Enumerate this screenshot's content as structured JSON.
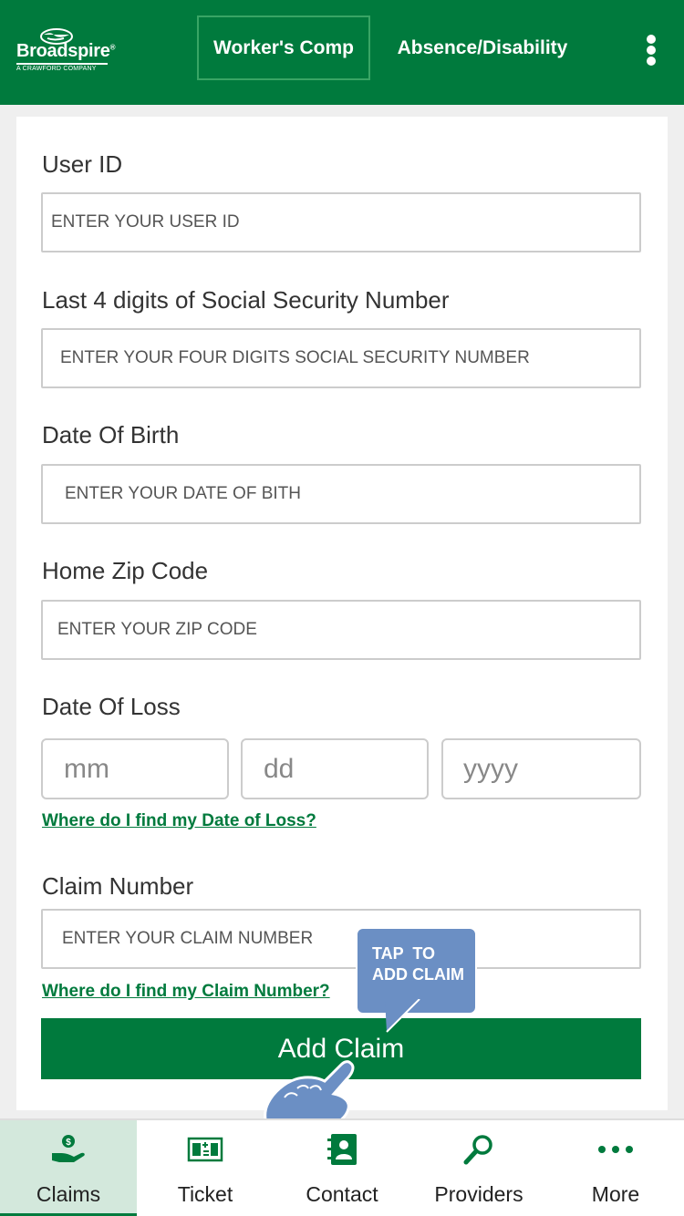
{
  "header": {
    "logo_name": "Broadspire",
    "logo_reg": "®",
    "logo_sub": "A CRAWFORD COMPANY",
    "tabs": [
      {
        "label": "Worker's Comp"
      },
      {
        "label": "Absence/Disability"
      }
    ],
    "menu_icon": "kebab-menu-icon"
  },
  "form": {
    "user_id_label": "User ID",
    "user_id_placeholder": "ENTER YOUR USER ID",
    "ssn_label": "Last 4 digits of Social Security Number",
    "ssn_placeholder": "ENTER YOUR FOUR DIGITS SOCIAL SECURITY NUMBER",
    "dob_label": "Date Of Birth",
    "dob_placeholder": "ENTER YOUR DATE OF BITH",
    "zip_label": "Home Zip Code",
    "zip_placeholder": "ENTER YOUR ZIP CODE",
    "loss_label": "Date Of Loss",
    "loss_mm": "mm",
    "loss_dd": "dd",
    "loss_yyyy": "yyyy",
    "loss_help": "Where do I find my Date of Loss?",
    "claim_label": "Claim Number",
    "claim_placeholder": "ENTER YOUR CLAIM NUMBER",
    "claim_help": "Where do I find my Claim Number?",
    "add_button": "Add Claim"
  },
  "tooltip": {
    "line1": "TAP  TO",
    "line2": "ADD CLAIM"
  },
  "bottom_nav": {
    "items": [
      {
        "label": "Claims",
        "icon": "hand-money-icon",
        "active": true
      },
      {
        "label": "Ticket",
        "icon": "ticket-icon"
      },
      {
        "label": "Contact",
        "icon": "contact-book-icon"
      },
      {
        "label": "Providers",
        "icon": "search-icon"
      },
      {
        "label": "More",
        "icon": "more-dots-icon"
      }
    ]
  },
  "colors": {
    "brand_green": "#007a3d",
    "tooltip_blue": "#6b8fc4",
    "active_tab_bg": "#d3e8dc"
  }
}
